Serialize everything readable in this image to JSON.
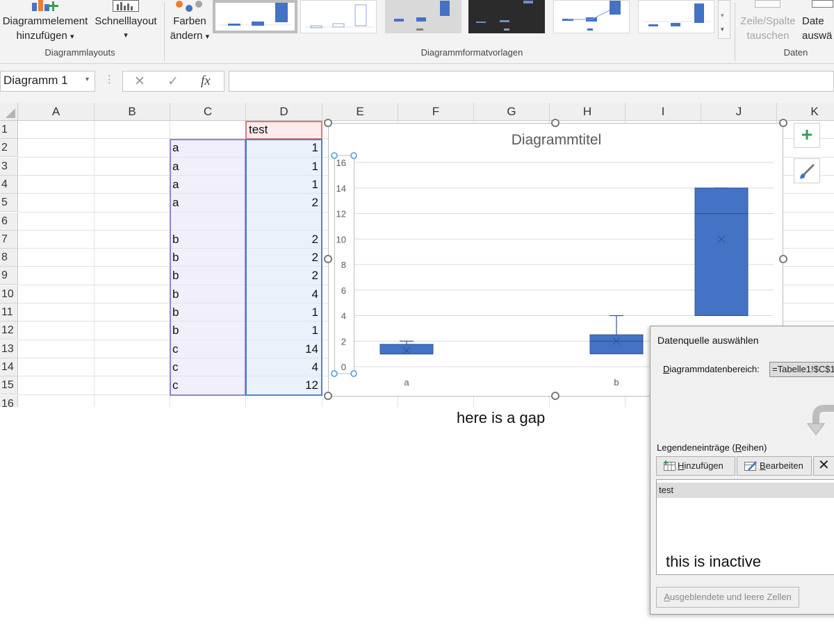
{
  "ribbon": {
    "add_element": {
      "line1": "Diagrammelement",
      "line2": "hinzufügen"
    },
    "quick_layout": {
      "line1": "Schnelllayout"
    },
    "change_colors": {
      "line1": "Farben",
      "line2": "ändern"
    },
    "switch_row_col": {
      "line1": "Zeile/Spalte",
      "line2": "tauschen"
    },
    "select_data": {
      "line1": "Date",
      "line2": "auswä"
    },
    "groups": {
      "layouts": "Diagrammlayouts",
      "styles": "Diagrammformatvorlagen",
      "data": "Daten"
    },
    "dropdown_glyph": "▾"
  },
  "formula_bar": {
    "name_box": "Diagramm 1",
    "name_arrow": "▾",
    "cancel_glyph": "✕",
    "enter_glyph": "✓",
    "fx": "fx",
    "dots": "⋮",
    "content": ""
  },
  "sheet": {
    "columns": [
      "A",
      "B",
      "C",
      "D",
      "E",
      "F",
      "G",
      "H",
      "I",
      "J",
      "K"
    ],
    "rows": [
      "1",
      "2",
      "3",
      "4",
      "5",
      "6",
      "7",
      "8",
      "9",
      "10",
      "11",
      "12",
      "13",
      "14",
      "15",
      "16"
    ],
    "header_D1": "test",
    "col_C": [
      "a",
      "a",
      "a",
      "a",
      "",
      "b",
      "b",
      "b",
      "b",
      "b",
      "b",
      "c",
      "c",
      "c"
    ],
    "col_D": [
      "1",
      "1",
      "1",
      "2",
      "",
      "2",
      "2",
      "2",
      "4",
      "1",
      "1",
      "14",
      "4",
      "12"
    ]
  },
  "chart": {
    "title": "Diagrammtitel",
    "y_ticks": [
      "0",
      "2",
      "4",
      "6",
      "8",
      "10",
      "12",
      "14",
      "16"
    ],
    "categories": [
      "a",
      "b"
    ],
    "plus_glyph": "+",
    "colors": {
      "box": "#4472c4",
      "box_edge": "#2f5597",
      "grid": "#d9d9d9",
      "handle_sel": "#4a9ad8"
    }
  },
  "chart_data": {
    "type": "box",
    "title": "Diagrammtitel",
    "ylim": [
      0,
      16
    ],
    "y_ticks": [
      0,
      2,
      4,
      6,
      8,
      10,
      12,
      14,
      16
    ],
    "categories": [
      "a",
      "b",
      "c"
    ],
    "boxes": [
      {
        "category": "a",
        "min": 1,
        "q1": 1,
        "median": 1,
        "q3": 1.75,
        "max": 2,
        "mean": 1.25
      },
      {
        "category": "b",
        "min": 1,
        "q1": 1,
        "median": 2,
        "q3": 2.5,
        "max": 4,
        "mean": 2
      },
      {
        "category": "c",
        "min": 4,
        "q1": 4,
        "median": 12,
        "q3": 14,
        "max": 14,
        "mean": 10
      }
    ],
    "grid": true,
    "legend": "none"
  },
  "annotations": {
    "gap": "here is a gap",
    "inactive": "this is inactive"
  },
  "dialog": {
    "title": "Datenquelle auswählen",
    "range_label_pre": "D",
    "range_label_rest": "iagrammdatenbereich:",
    "range_value": "=Tabelle1!$C$1",
    "legend_label_pre": "Legendeneinträge (",
    "legend_label_u": "R",
    "legend_label_post": "eihen)",
    "add_u": "H",
    "add_rest": "inzufügen",
    "edit_u": "B",
    "edit_rest": "earbeiten",
    "remove_glyph": "✕",
    "series": [
      "test"
    ],
    "hidden_u": "A",
    "hidden_rest": "usgeblendete und leere Zellen"
  }
}
